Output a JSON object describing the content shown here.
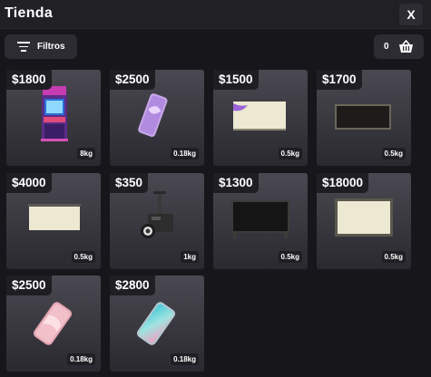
{
  "header": {
    "title": "Tienda",
    "close_label": "X"
  },
  "toolbar": {
    "filter_label": "Filtros",
    "cart_count": "0"
  },
  "items": [
    {
      "price": "$1800",
      "weight": "8kg",
      "icon": "arcade-machine-icon"
    },
    {
      "price": "$2500",
      "weight": "0.18kg",
      "icon": "phone-icon"
    },
    {
      "price": "$1500",
      "weight": "0.5kg",
      "icon": "canvas-icon"
    },
    {
      "price": "$1700",
      "weight": "0.5kg",
      "icon": "dark-panel-icon"
    },
    {
      "price": "$4000",
      "weight": "0.5kg",
      "icon": "projector-screen-icon"
    },
    {
      "price": "$350",
      "weight": "1kg",
      "icon": "ceiling-projector-icon"
    },
    {
      "price": "$1300",
      "weight": "0.5kg",
      "icon": "tv-icon"
    },
    {
      "price": "$18000",
      "weight": "0.5kg",
      "icon": "framed-screen-icon"
    },
    {
      "price": "$2500",
      "weight": "0.18kg",
      "icon": "phone-pink-icon"
    },
    {
      "price": "$2800",
      "weight": "0.18kg",
      "icon": "phone-gradient-icon"
    }
  ]
}
